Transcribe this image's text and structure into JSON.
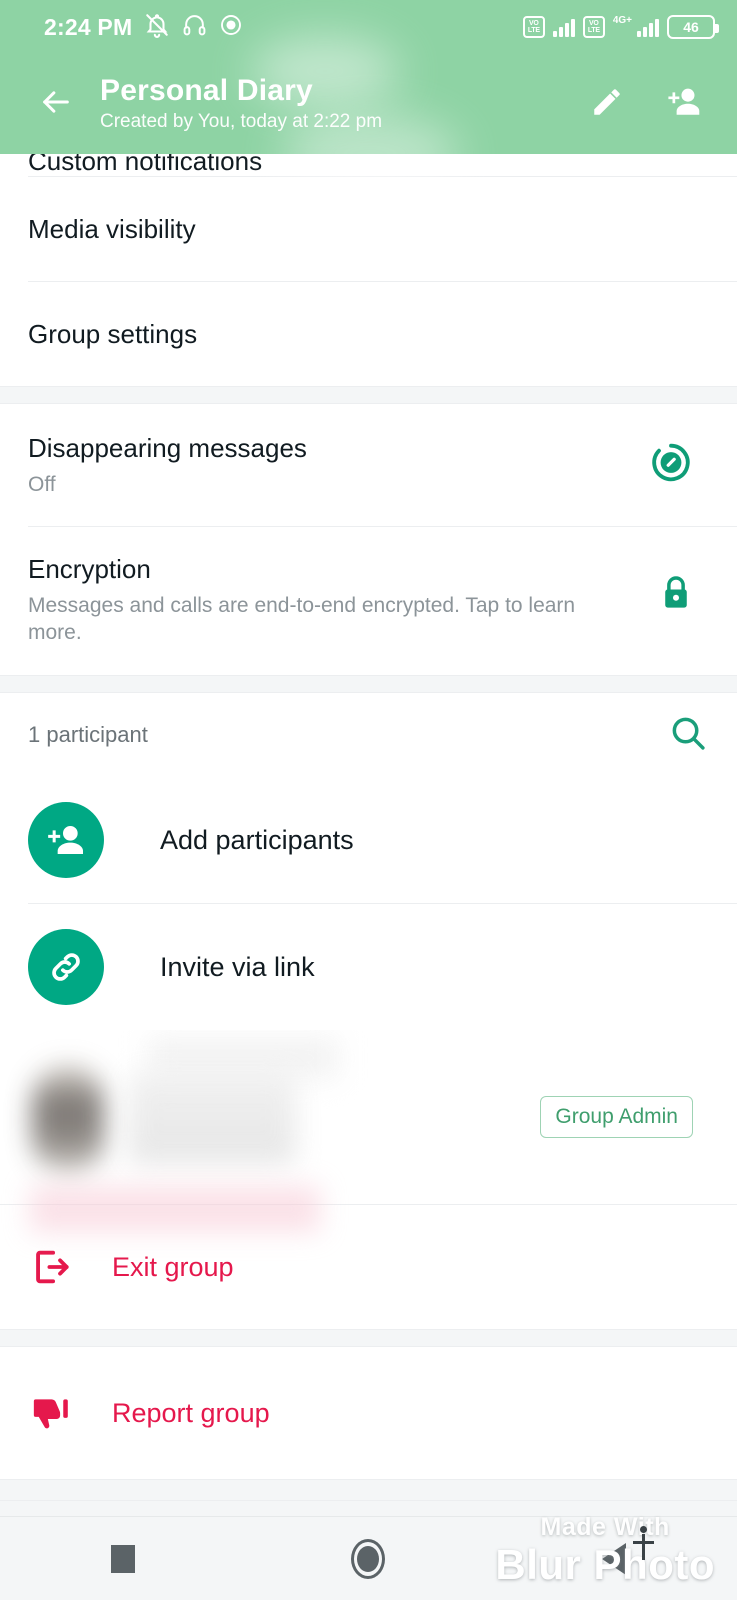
{
  "status_bar": {
    "time": "2:24 PM",
    "icons_left": [
      "bell-muted-icon",
      "headphones-icon",
      "screen-record-icon"
    ],
    "sim1_label": "VoLTE",
    "sim2_label": "VoLTE",
    "network_type": "4G+",
    "battery_percent": "46"
  },
  "app_bar": {
    "back_icon": "back-arrow-icon",
    "title": "Personal Diary",
    "subtitle": "Created by You, today at 2:22 pm",
    "edit_icon": "pencil-icon",
    "add_member_icon": "add-person-icon"
  },
  "settings_section": {
    "clipped_item": "Custom notifications",
    "items": [
      {
        "label": "Media visibility"
      },
      {
        "label": "Group settings"
      }
    ]
  },
  "privacy_section": {
    "disappearing": {
      "title": "Disappearing messages",
      "value": "Off",
      "icon": "timer-icon"
    },
    "encryption": {
      "title": "Encryption",
      "description": "Messages and calls are end-to-end encrypted. Tap to learn more.",
      "icon": "lock-icon"
    }
  },
  "participants_section": {
    "count_label": "1 participant",
    "search_icon": "search-icon",
    "actions": [
      {
        "label": "Add participants",
        "icon": "add-person-icon"
      },
      {
        "label": "Invite via link",
        "icon": "link-icon"
      }
    ],
    "members": [
      {
        "name": "",
        "badge": "Group Admin",
        "blurred": true
      }
    ]
  },
  "danger_section": {
    "exit": {
      "label": "Exit group",
      "icon": "exit-icon"
    },
    "report": {
      "label": "Report group",
      "icon": "thumbs-down-icon"
    }
  },
  "nav_bar": {
    "recents_icon": "square-recents-icon",
    "home_icon": "circle-home-icon",
    "back_icon": "triangle-back-icon"
  },
  "watermark": {
    "line1": "Made With",
    "line2": "Blur Photo"
  },
  "colors": {
    "header_green": "#8ed3a4",
    "accent_green": "#00a884",
    "icon_green": "#1a9e7a",
    "danger_red": "#e5184c",
    "badge_green": "#3f9e6d",
    "title_text": "#111b21",
    "sub_text": "#8c9499"
  }
}
